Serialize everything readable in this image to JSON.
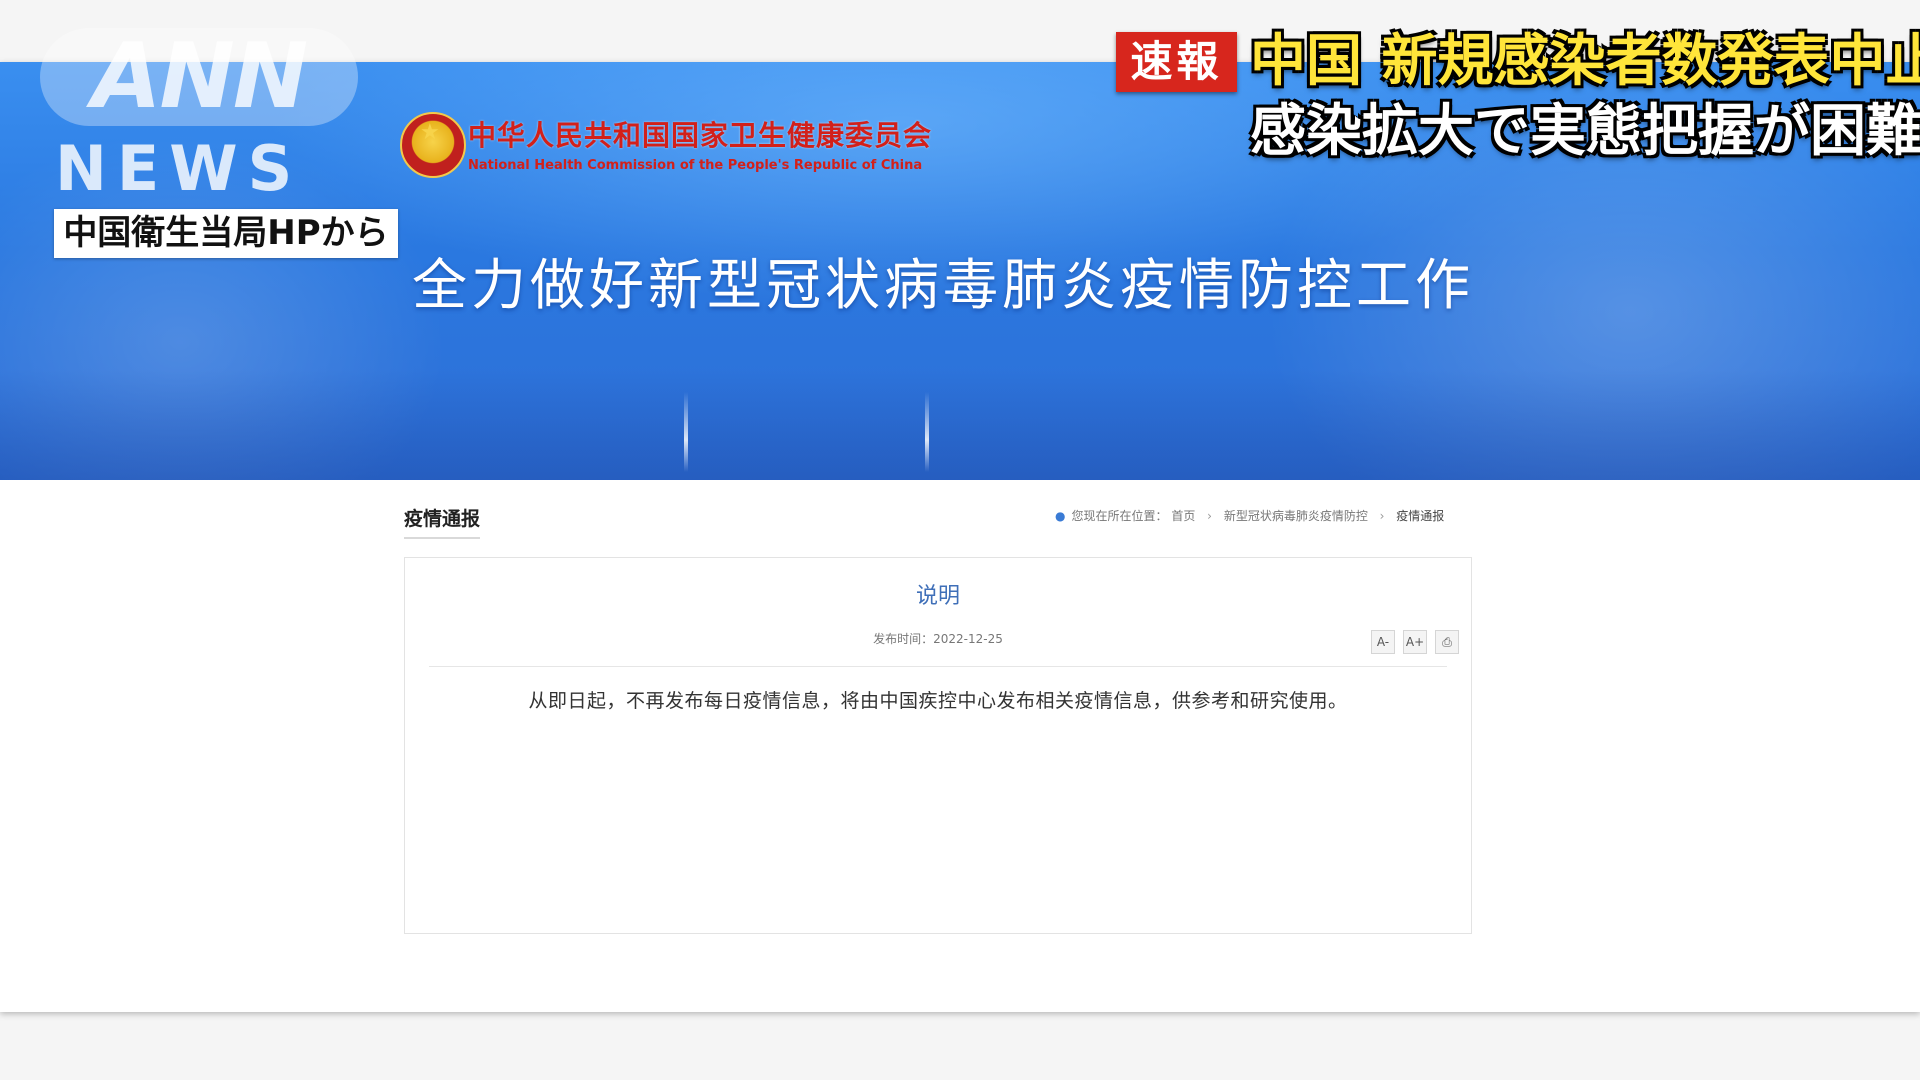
{
  "broadcast": {
    "network_logo": "ANN",
    "network_sub": "NEWS",
    "source_label": "中国衛生当局HPから",
    "breaking_badge": "速報",
    "headline_line1": "中国 新規感染者数発表中止",
    "headline_line2": "感染拡大で実態把握が困難か",
    "colors": {
      "badge": "#d7261d",
      "headline1": "#ffe53a",
      "headline2": "#ffffff"
    }
  },
  "site": {
    "org_name_cn": "中华人民共和国国家卫生健康委员会",
    "org_name_en": "National Health Commission of the People's Republic of China",
    "emblem_icon": "national-emblem-icon",
    "banner_title": "全力做好新型冠状病毒肺炎疫情防控工作",
    "colors": {
      "banner": "#2f7fe6",
      "org_name": "#d2201a",
      "article_title": "#3f6fb8"
    }
  },
  "content": {
    "section_title": "疫情通报",
    "breadcrumb": {
      "prefix": "您现在所在位置：",
      "items": [
        "首页",
        "新型冠状病毒肺炎疫情防控",
        "疫情通报"
      ]
    },
    "article": {
      "title": "说明",
      "publish_date": "发布时间：2022-12-25",
      "body": "从即日起，不再发布每日疫情信息，将由中国疾控中心发布相关疫情信息，供参考和研究使用。",
      "tools": [
        "A-",
        "A+",
        "print-icon"
      ]
    }
  }
}
